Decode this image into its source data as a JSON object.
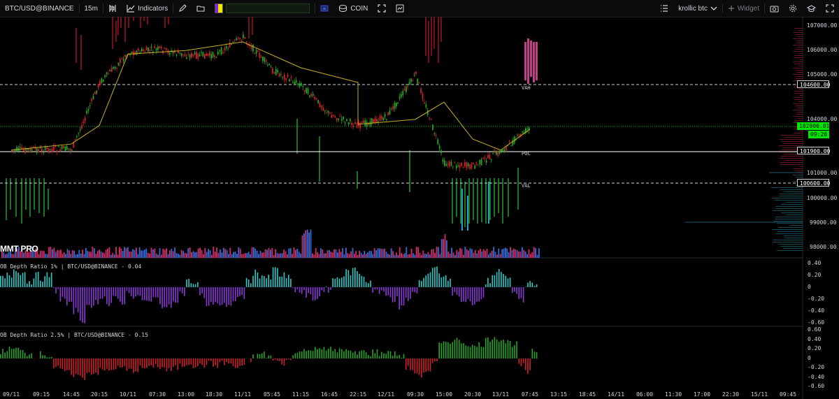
{
  "toolbar": {
    "symbol": "BTC/USD@BINANCE",
    "interval": "15m",
    "indicators_label": "Indicators",
    "exchange_label": "COIN",
    "layout_name": "krollic btc",
    "widget_label": "Widget",
    "icons": [
      "candles-icon",
      "indicators-icon",
      "pencil-icon",
      "folder-icon",
      "coin-icon",
      "fullscreen-icon",
      "snapshot-icon",
      "list-icon",
      "camera-icon",
      "gear-icon",
      "graduation-icon",
      "expand-icon"
    ]
  },
  "brand_watermark": "MMT PRO",
  "colors": {
    "up": "#26a626",
    "down": "#d0202a",
    "vwap": "#c8b020",
    "cyan": "#2ec9c9",
    "purple": "#8a3ad8",
    "vol_blue": "#3a6ad8",
    "vol_red": "#d0306a",
    "wick_down": "#8b1020",
    "wick_up_bar": "#1e8a2a",
    "price_tag": "#00e600"
  },
  "levels": [
    {
      "name": "VAH",
      "price": "104600.00"
    },
    {
      "name": "POC",
      "price": "101900.00"
    },
    {
      "name": "VAL",
      "price": "100600.00"
    }
  ],
  "current_price": {
    "price": "102900.01",
    "countdown": "09:20"
  },
  "price_axis": [
    "107000.00",
    "106000.00",
    "105000.00",
    "104000.00",
    "101000.00",
    "100000.00",
    "99000.00",
    "98000.00"
  ],
  "indicator1": {
    "title": "OB Depth Ratio 1% | BTC/USD@BINANCE - 0.04",
    "axis": [
      "0.40",
      "0.20",
      "0",
      "-0.20",
      "-0.40",
      "-0.60"
    ]
  },
  "indicator2": {
    "title": "OB Depth Ratio 2.5% | BTC/USD@BINANCE - 0.15",
    "axis": [
      "0.60",
      "0.40",
      "0.20",
      "0",
      "-0.20",
      "-0.40",
      "-0.60"
    ]
  },
  "time_axis": [
    "09/11",
    "09:15",
    "14:45",
    "20:15",
    "10/11",
    "07:30",
    "13:00",
    "18:30",
    "11/11",
    "05:45",
    "11:15",
    "16:45",
    "22:15",
    "12/11",
    "09:30",
    "15:00",
    "20:30",
    "13/11",
    "07:45",
    "13:15",
    "18:45",
    "14/11",
    "06:00",
    "11:30",
    "17:00",
    "22:30",
    "15/11",
    "09:45"
  ],
  "chart_data": {
    "type": "candlestick",
    "symbol": "BTC/USD@BINANCE",
    "interval": "15m",
    "ylim": [
      97800,
      107400
    ],
    "price_path": [
      {
        "t": "09/11",
        "p": 101950
      },
      {
        "t": "14:45",
        "p": 102000
      },
      {
        "t": "20:15",
        "p": 104700
      },
      {
        "t": "10/11",
        "p": 105900
      },
      {
        "t": "07:30",
        "p": 106050
      },
      {
        "t": "13:00",
        "p": 105800
      },
      {
        "t": "18:30",
        "p": 105800
      },
      {
        "t": "11/11",
        "p": 106550
      },
      {
        "t": "05:45",
        "p": 105200
      },
      {
        "t": "11:15",
        "p": 104600
      },
      {
        "t": "16:45",
        "p": 103400
      },
      {
        "t": "22:15",
        "p": 102950
      },
      {
        "t": "12/11",
        "p": 103300
      },
      {
        "t": "09:30",
        "p": 105000
      },
      {
        "t": "15:00",
        "p": 101400
      },
      {
        "t": "20:30",
        "p": 101300
      },
      {
        "t": "13/11",
        "p": 101900
      },
      {
        "t": "07:45",
        "p": 102900
      }
    ],
    "vwap_path": [
      {
        "t": "09/11",
        "p": 101950
      },
      {
        "t": "14:45",
        "p": 102200
      },
      {
        "t": "20:15",
        "p": 102950
      },
      {
        "t": "10/11",
        "p": 105850
      },
      {
        "t": "13:00",
        "p": 106000
      },
      {
        "t": "11/11",
        "p": 106350
      },
      {
        "t": "11:15",
        "p": 105300
      },
      {
        "t": "22:15",
        "p": 104700
      },
      {
        "t": "22:15",
        "p": 103000
      },
      {
        "t": "09:30",
        "p": 103200
      },
      {
        "t": "15:00",
        "p": 103900
      },
      {
        "t": "20:30",
        "p": 102400
      },
      {
        "t": "13/11",
        "p": 101950
      },
      {
        "t": "07:45",
        "p": 102800
      }
    ],
    "ob_depth_1pct": {
      "ylim": [
        -0.65,
        0.45
      ],
      "values": [
        0.15,
        0.2,
        0.3,
        0.25,
        0.1,
        0.2,
        0.15,
        0.2,
        -0.05,
        -0.2,
        -0.3,
        -0.4,
        -0.55,
        -0.35,
        -0.25,
        -0.15,
        -0.3,
        -0.2,
        -0.25,
        -0.1,
        -0.15,
        -0.2,
        -0.25,
        -0.2,
        -0.3,
        -0.35,
        -0.2,
        -0.1,
        0.1,
        0.05,
        -0.15,
        -0.3,
        -0.25,
        -0.3,
        -0.35,
        -0.2,
        -0.15,
        0.1,
        0.25,
        0.2,
        0.15,
        0.3,
        0.2,
        0.15,
        -0.05,
        -0.1,
        -0.15,
        -0.2,
        -0.1,
        -0.05,
        0.15,
        0.2,
        0.25,
        0.3,
        0.2,
        0.1,
        -0.05,
        -0.1,
        -0.15,
        -0.2,
        -0.35,
        -0.2,
        -0.1,
        0.1,
        0.25,
        0.35,
        0.2,
        0.15,
        -0.1,
        -0.2,
        -0.25,
        -0.3,
        -0.2,
        0.1,
        0.2,
        0.25,
        0.15,
        -0.1,
        -0.2,
        0.05,
        0.04
      ]
    },
    "ob_depth_2_5pct": {
      "ylim": [
        -0.65,
        0.65
      ],
      "values": [
        0.15,
        0.2,
        0.2,
        0.15,
        0.1,
        0.05,
        0.1,
        0.05,
        -0.2,
        -0.25,
        -0.3,
        -0.35,
        -0.4,
        -0.3,
        -0.3,
        -0.25,
        -0.25,
        -0.2,
        -0.2,
        -0.25,
        -0.25,
        -0.2,
        -0.2,
        -0.15,
        -0.2,
        -0.25,
        -0.2,
        -0.15,
        -0.1,
        -0.15,
        -0.15,
        -0.1,
        -0.15,
        -0.1,
        -0.1,
        -0.2,
        -0.15,
        -0.05,
        0.05,
        0.1,
        0.05,
        -0.05,
        -0.1,
        -0.05,
        0.1,
        0.2,
        0.15,
        0.2,
        0.25,
        0.2,
        0.15,
        0.2,
        0.15,
        0.1,
        0.15,
        0.1,
        0.15,
        0.1,
        0.15,
        0.1,
        0.05,
        -0.2,
        -0.3,
        -0.35,
        -0.25,
        -0.1,
        0.3,
        0.35,
        0.4,
        0.35,
        0.3,
        0.25,
        0.3,
        0.4,
        0.45,
        0.4,
        0.35,
        0.3,
        -0.15,
        -0.3,
        0.15
      ]
    }
  }
}
